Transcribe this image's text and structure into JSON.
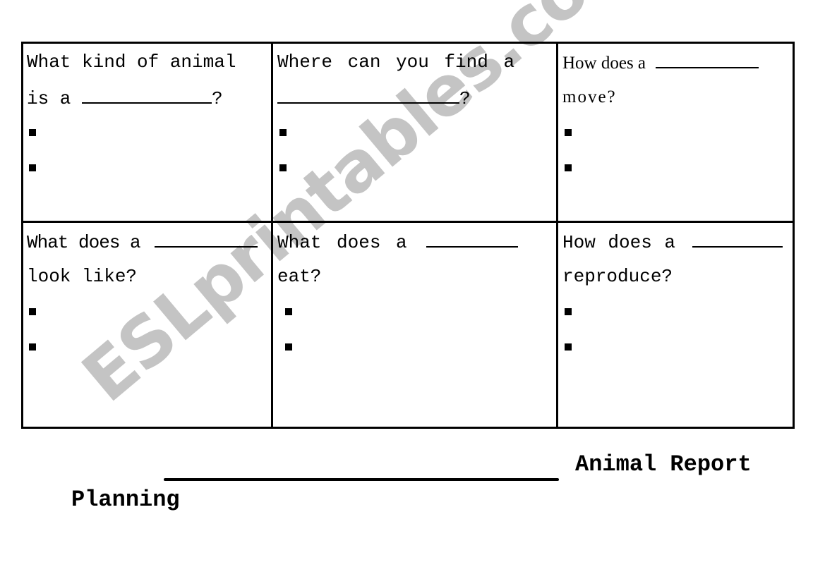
{
  "watermark": "ESLprintables.com",
  "worksheet": {
    "title": "Animal Report",
    "subtitle": "Planning",
    "cells": [
      {
        "line1": "What kind of animal",
        "line2_prefix": "is a ",
        "line2_suffix": "?",
        "blank_on": "line2",
        "bullets": 2
      },
      {
        "line1": "Where can you find a",
        "line2_prefix": "",
        "line2_suffix": "?",
        "blank_on": "line2",
        "bullets": 2
      },
      {
        "line1": "How does a ",
        "line2_prefix": "move?",
        "line2_suffix": "",
        "blank_on": "line1",
        "bullets": 2
      },
      {
        "line1": "What does a ",
        "line2_prefix": "look like?",
        "line2_suffix": "",
        "blank_on": "line1",
        "bullets": 2
      },
      {
        "line1": "What does a ",
        "line2_prefix": "eat?",
        "line2_suffix": "",
        "blank_on": "line1",
        "bullets": 2
      },
      {
        "line1": "How does a ",
        "line2_prefix": "reproduce?",
        "line2_suffix": "",
        "blank_on": "line1",
        "bullets": 2
      }
    ]
  }
}
